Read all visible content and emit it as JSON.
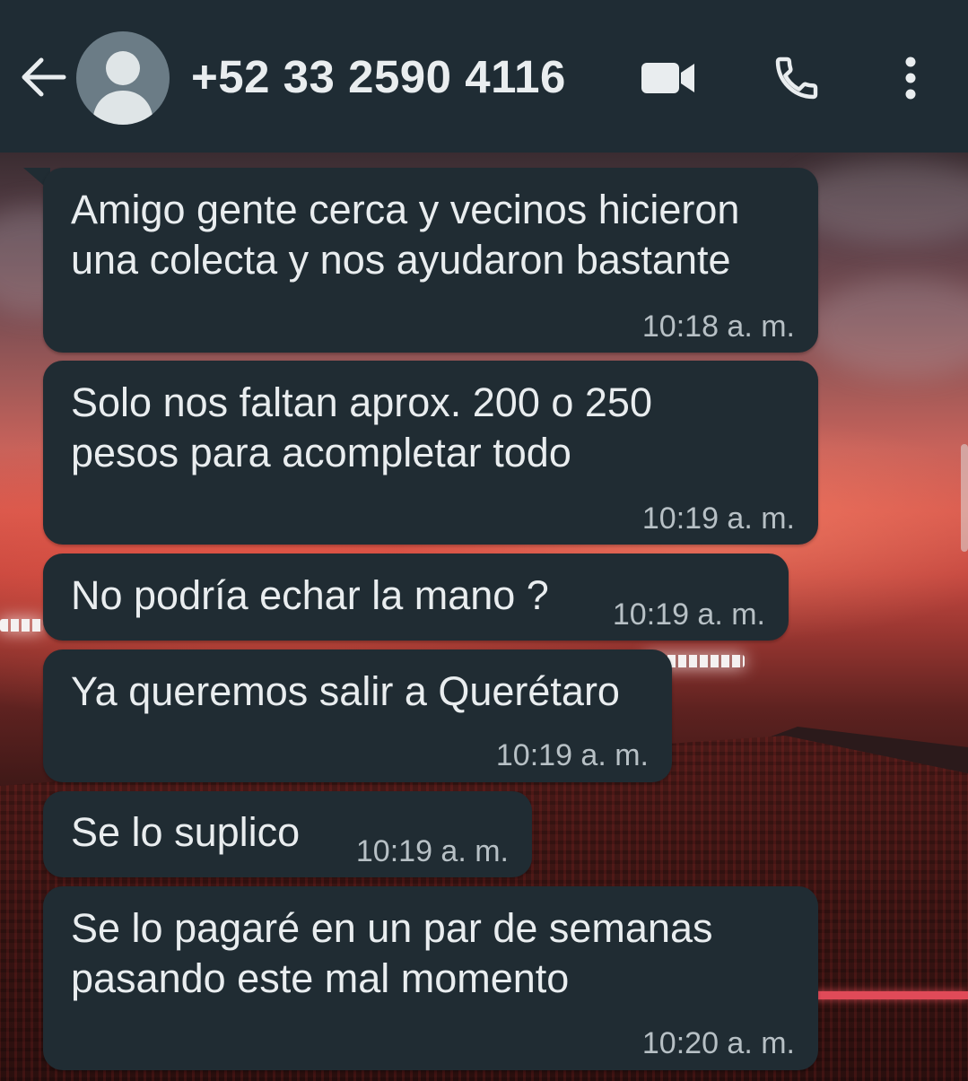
{
  "header": {
    "contact": "+52 33 2590 4116",
    "icons": {
      "back": "arrow-left-icon",
      "avatar": "default-person-icon",
      "video": "video-camera-icon",
      "call": "phone-icon",
      "menu": "more-vertical-icon"
    }
  },
  "messages": [
    {
      "lines": [
        "Amigo gente cerca y vecinos hicieron",
        "una colecta y nos ayudaron bastante"
      ],
      "time": "10:18 a. m."
    },
    {
      "lines": [
        "Solo nos faltan aprox. 200 o 250",
        "pesos para acompletar todo"
      ],
      "time": "10:19 a. m."
    },
    {
      "lines": [
        "No podría echar la mano ?"
      ],
      "time": "10:19 a. m."
    },
    {
      "lines": [
        "Ya queremos salir a Querétaro"
      ],
      "time": "10:19 a. m."
    },
    {
      "lines": [
        "Se lo suplico"
      ],
      "time": "10:19 a. m."
    },
    {
      "lines": [
        "Se lo pagaré en un par de semanas",
        "pasando este mal momento"
      ],
      "time": "10:20 a. m."
    }
  ],
  "colors": {
    "appbar": "#1f2c34",
    "bubble": "#202c33",
    "text": "#e9edef",
    "timestamp": "#b7c0c5"
  }
}
